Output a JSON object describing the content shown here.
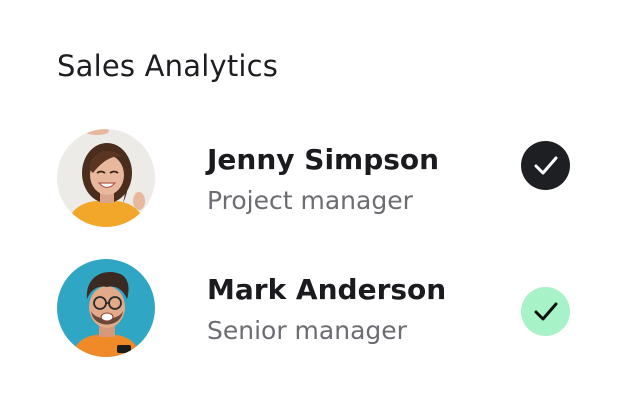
{
  "card": {
    "title": "Sales Analytics"
  },
  "people": [
    {
      "name": "Jenny Simpson",
      "role": "Project manager",
      "status_icon": "check-icon",
      "status_color": "#1e1f23"
    },
    {
      "name": "Mark Anderson",
      "role": "Senior manager",
      "status_icon": "check-icon",
      "status_color": "#a7f2c6"
    }
  ]
}
